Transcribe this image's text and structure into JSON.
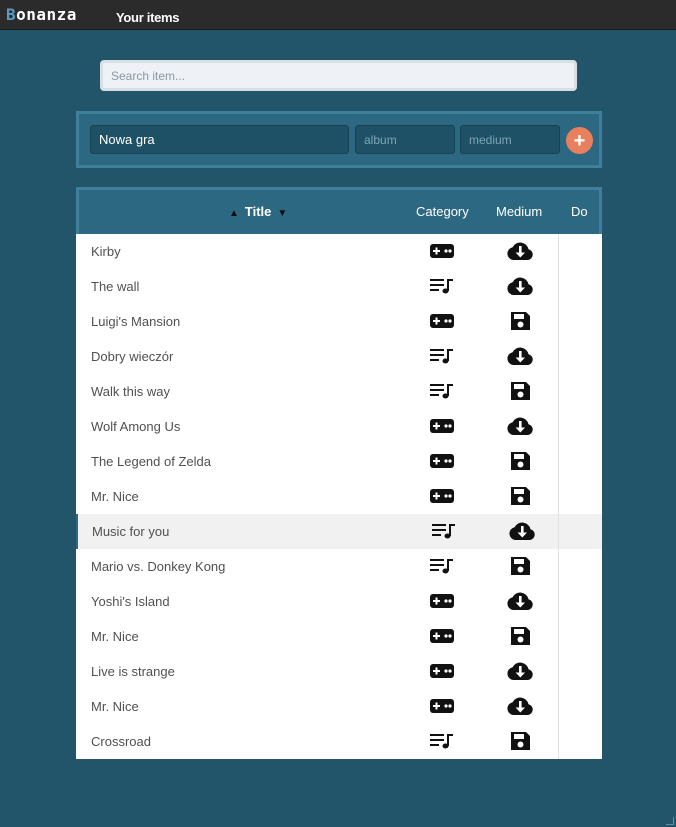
{
  "header": {
    "logo_first": "B",
    "logo_rest": "onanza",
    "nav_link": "Your items"
  },
  "search": {
    "placeholder": "Search item..."
  },
  "add_form": {
    "title_value": "Nowa gra",
    "category_placeholder": "album",
    "medium_placeholder": "medium",
    "add_label": "+"
  },
  "table": {
    "columns": {
      "title": "Title",
      "category": "Category",
      "medium": "Medium",
      "do": "Do"
    },
    "sort_up": "▲",
    "sort_down": "▼",
    "rows": [
      {
        "title": "Kirby",
        "category": "game",
        "medium": "cloud"
      },
      {
        "title": "The wall",
        "category": "music",
        "medium": "cloud"
      },
      {
        "title": "Luigi's Mansion",
        "category": "game",
        "medium": "disk"
      },
      {
        "title": "Dobry wieczór",
        "category": "music",
        "medium": "cloud"
      },
      {
        "title": "Walk this way",
        "category": "music",
        "medium": "disk"
      },
      {
        "title": "Wolf Among Us",
        "category": "game",
        "medium": "cloud"
      },
      {
        "title": "The Legend of Zelda",
        "category": "game",
        "medium": "disk"
      },
      {
        "title": "Mr. Nice",
        "category": "game",
        "medium": "disk"
      },
      {
        "title": "Music for you",
        "category": "music",
        "medium": "cloud",
        "highlighted": true
      },
      {
        "title": "Mario vs. Donkey Kong",
        "category": "music",
        "medium": "disk"
      },
      {
        "title": "Yoshi's Island",
        "category": "game",
        "medium": "cloud"
      },
      {
        "title": "Mr. Nice",
        "category": "game",
        "medium": "disk"
      },
      {
        "title": "Live is strange",
        "category": "game",
        "medium": "cloud"
      },
      {
        "title": "Mr. Nice",
        "category": "game",
        "medium": "cloud"
      },
      {
        "title": "Crossroad",
        "category": "music",
        "medium": "disk"
      }
    ]
  },
  "icons": {
    "game": "gamepad-icon",
    "music": "playlist-music-icon",
    "cloud": "cloud-download-icon",
    "disk": "floppy-disk-icon"
  },
  "colors": {
    "background": "#22556a",
    "topbar": "#2b2b2b",
    "panel": "#2d6882",
    "accent_button": "#e8805e"
  }
}
